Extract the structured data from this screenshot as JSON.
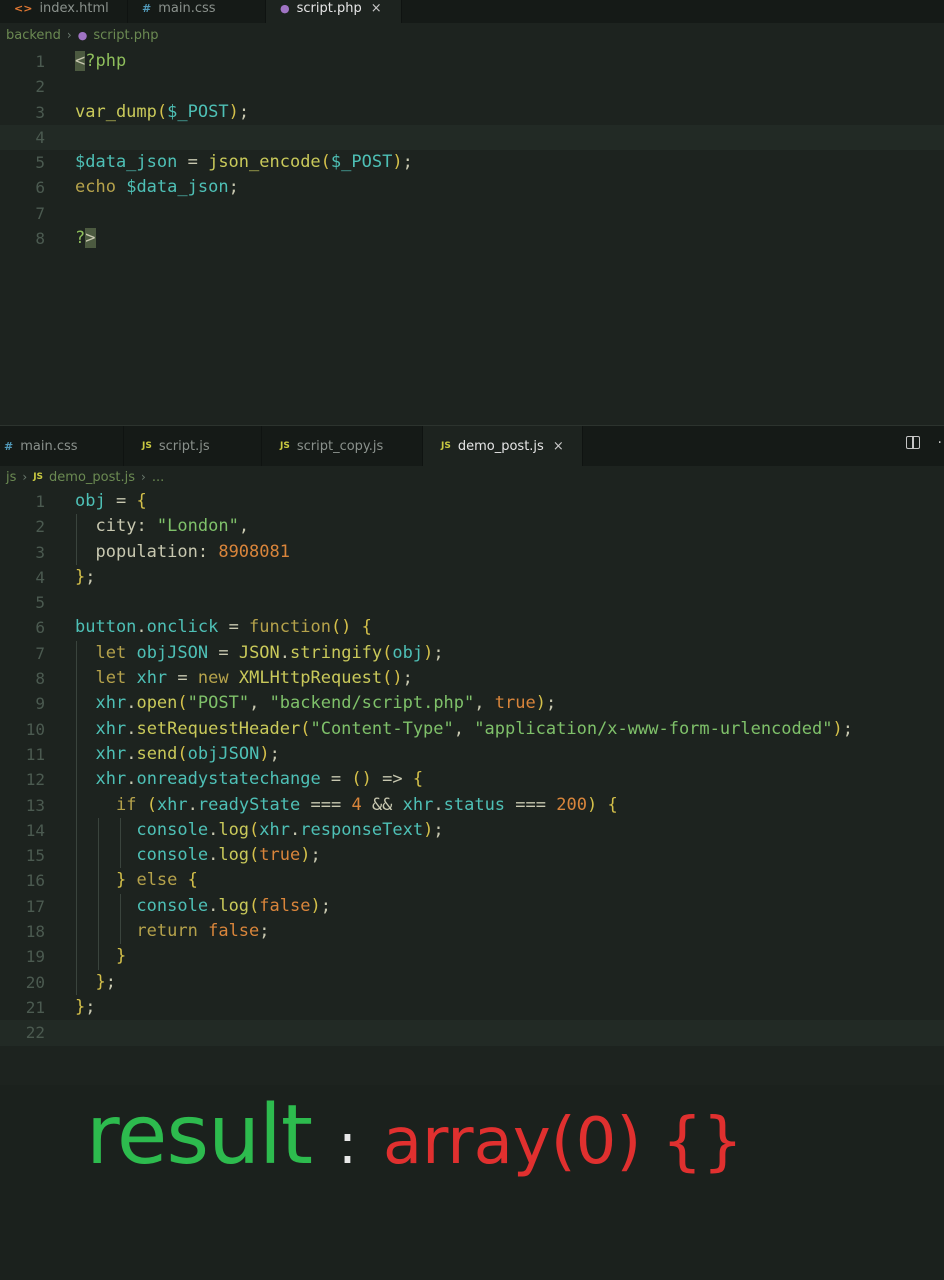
{
  "top_editor": {
    "tabs": [
      {
        "label": "index.html",
        "icon": "html-file-icon"
      },
      {
        "label": "main.css",
        "icon": "css-file-icon"
      },
      {
        "label": "script.php",
        "icon": "php-file-icon",
        "active": true,
        "close": "×"
      }
    ],
    "breadcrumb": [
      "backend",
      "script.php"
    ],
    "line_numbers": [
      "1",
      "2",
      "3",
      "4",
      "5",
      "6",
      "7",
      "8"
    ]
  },
  "bottom_editor": {
    "tabs": [
      {
        "label": "main.css",
        "icon": "css-file-icon"
      },
      {
        "label": "script.js",
        "icon": "js-file-icon"
      },
      {
        "label": "script_copy.js",
        "icon": "js-file-icon"
      },
      {
        "label": "demo_post.js",
        "icon": "js-file-icon",
        "active": true,
        "close": "×"
      }
    ],
    "breadcrumb": [
      "js",
      "demo_post.js",
      "..."
    ],
    "line_numbers": [
      "1",
      "2",
      "3",
      "4",
      "5",
      "6",
      "7",
      "8",
      "9",
      "10",
      "11",
      "12",
      "13",
      "14",
      "15",
      "16",
      "17",
      "18",
      "19",
      "20",
      "21",
      "22"
    ]
  },
  "icon_glyphs": {
    "css": "#",
    "js": "JS",
    "html": "<>",
    "php": "🐘"
  },
  "result": {
    "label": "result",
    "colon": ":",
    "value": "array(0) {}"
  },
  "colors": {
    "background": "#1b211d",
    "result_label": "#2dbb4e",
    "result_value": "#e0302f"
  }
}
